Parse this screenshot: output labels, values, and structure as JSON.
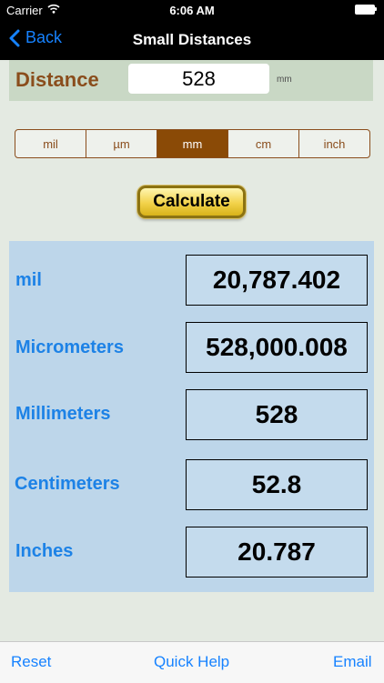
{
  "status_bar": {
    "carrier": "Carrier",
    "time": "6:06 AM"
  },
  "nav": {
    "back_label": "Back",
    "title": "Small Distances"
  },
  "distance": {
    "label": "Distance",
    "value": "528",
    "unit": "mm"
  },
  "units": {
    "options": [
      "mil",
      "µm",
      "mm",
      "cm",
      "inch"
    ],
    "selected": "mm"
  },
  "calculate_label": "Calculate",
  "results": [
    {
      "label": "mil",
      "value": "20,787.402"
    },
    {
      "label": "Micrometers",
      "value": "528,000.008"
    },
    {
      "label": "Millimeters",
      "value": "528"
    },
    {
      "label": "Centimeters",
      "value": "52.8"
    },
    {
      "label": "Inches",
      "value": "20.787"
    }
  ],
  "toolbar": {
    "reset_label": "Reset",
    "help_label": "Quick Help",
    "email_label": "Email"
  },
  "colors": {
    "accent": "#1682ff",
    "brown": "#8a4d1c",
    "results_bg": "#bdd6ea",
    "result_label": "#1d82e6"
  }
}
